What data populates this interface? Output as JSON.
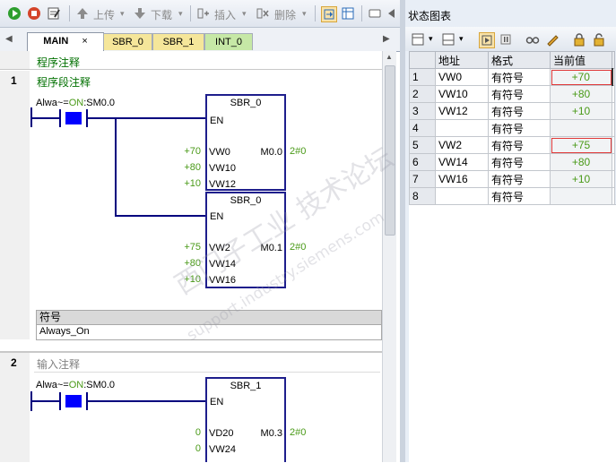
{
  "toolbar": {
    "upload_label": "上传",
    "download_label": "下载",
    "insert_label": "插入",
    "delete_label": "删除"
  },
  "tabs": [
    {
      "label": "MAIN",
      "close": "×"
    },
    {
      "label": "SBR_0"
    },
    {
      "label": "SBR_1"
    },
    {
      "label": "INT_0"
    }
  ],
  "editor": {
    "program_comment": "程序注释",
    "networks": [
      {
        "number": "1",
        "comment": "程序段注释",
        "contact": {
          "prefix": "Alwa~=",
          "state": "ON",
          "suffix": ":SM0.0"
        },
        "blocks": [
          {
            "title": "SBR_0",
            "en": "EN",
            "inputs": [
              {
                "value": "+70",
                "name": "VW0"
              },
              {
                "value": "+80",
                "name": "VW10"
              },
              {
                "value": "+10",
                "name": "VW12"
              }
            ],
            "output": {
              "name": "M0.0",
              "value": "2#0"
            }
          },
          {
            "title": "SBR_0",
            "en": "EN",
            "inputs": [
              {
                "value": "+75",
                "name": "VW2"
              },
              {
                "value": "+80",
                "name": "VW14"
              },
              {
                "value": "+10",
                "name": "VW16"
              }
            ],
            "output": {
              "name": "M0.1",
              "value": "2#0"
            }
          }
        ],
        "symbol_header": "符号",
        "symbol_value": "Always_On"
      },
      {
        "number": "2",
        "comment": "输入注释",
        "contact": {
          "prefix": "Alwa~=",
          "state": "ON",
          "suffix": ":SM0.0"
        },
        "blocks": [
          {
            "title": "SBR_1",
            "en": "EN",
            "inputs": [
              {
                "value": "0",
                "name": "VD20"
              },
              {
                "value": "0",
                "name": "VW24"
              }
            ],
            "output": {
              "name": "M0.3",
              "value": "2#0"
            }
          }
        ]
      }
    ]
  },
  "status_chart": {
    "title": "状态图表",
    "columns": [
      "地址",
      "格式",
      "当前值"
    ],
    "rows": [
      {
        "no": "1",
        "address": "VW0",
        "format": "有符号",
        "value": "+70"
      },
      {
        "no": "2",
        "address": "VW10",
        "format": "有符号",
        "value": "+80"
      },
      {
        "no": "3",
        "address": "VW12",
        "format": "有符号",
        "value": "+10"
      },
      {
        "no": "4",
        "address": "",
        "format": "有符号",
        "value": ""
      },
      {
        "no": "5",
        "address": "VW2",
        "format": "有符号",
        "value": "+75"
      },
      {
        "no": "6",
        "address": "VW14",
        "format": "有符号",
        "value": "+80"
      },
      {
        "no": "7",
        "address": "VW16",
        "format": "有符号",
        "value": "+10"
      },
      {
        "no": "8",
        "address": "",
        "format": "有符号",
        "value": ""
      }
    ]
  },
  "watermark": {
    "line1": "西门子工业 技术论坛",
    "line2": "support.industry.siemens.com"
  },
  "colors": {
    "ladder_blue": "#00007e",
    "value_green": "#4a9a18",
    "comment_green": "#007000",
    "highlight_red": "#e03838"
  }
}
